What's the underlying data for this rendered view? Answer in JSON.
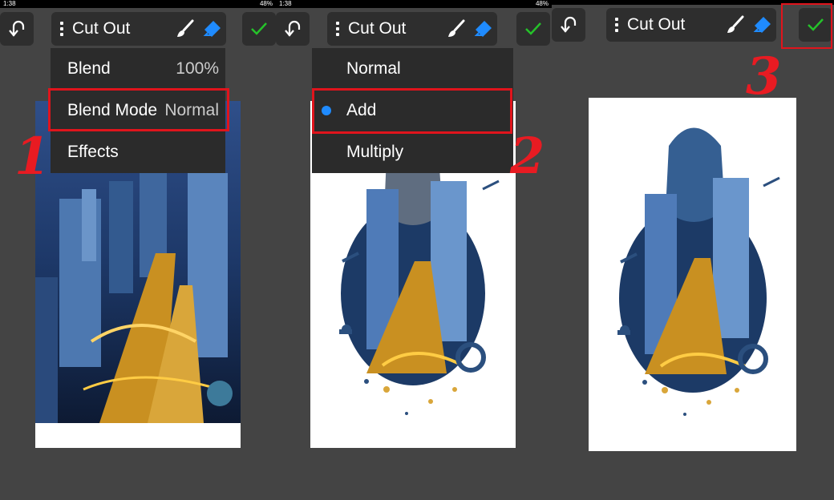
{
  "status": {
    "time": "1:38",
    "right": "48%"
  },
  "toolbar": {
    "tool_label": "Cut Out"
  },
  "panel1": {
    "menu": {
      "blend_label": "Blend",
      "blend_value": "100%",
      "blend_mode_label": "Blend Mode",
      "blend_mode_value": "Normal",
      "effects_label": "Effects"
    },
    "step_number": "1"
  },
  "panel2": {
    "menu": {
      "options": [
        "Normal",
        "Add",
        "Multiply"
      ],
      "selected": "Add"
    },
    "step_number": "2"
  },
  "panel3": {
    "step_number": "3"
  },
  "colors": {
    "accent_blue": "#1f8bff",
    "confirm_green": "#25c22a",
    "annotation_red": "#e0141c",
    "background": "#444444"
  }
}
